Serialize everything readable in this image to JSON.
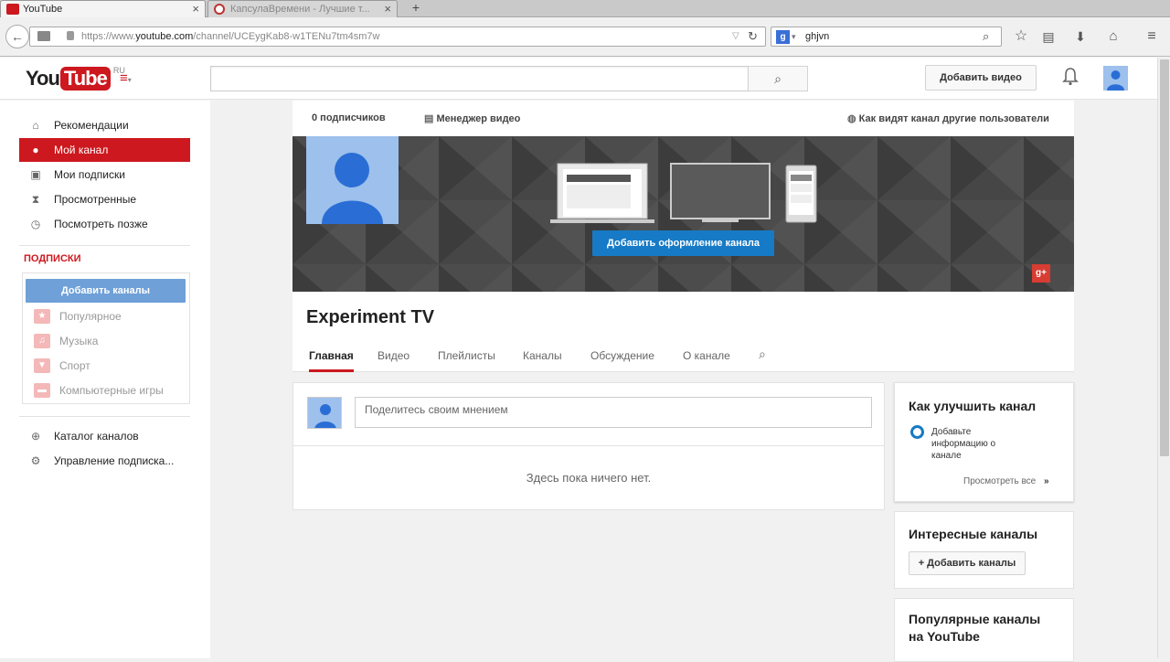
{
  "browser": {
    "tabs": [
      {
        "title": "YouTube",
        "active": true
      },
      {
        "title": "КапсулаВремени - Лучшие т...",
        "active": false
      }
    ],
    "url_prefix": "https://www.",
    "url_host": "youtube.com",
    "url_path": "/channel/UCEygKab8-w1TENu7tm4sm7w",
    "search_text": "ghjvn"
  },
  "header": {
    "logo_you": "You",
    "logo_tube": "Tube",
    "logo_region": "RU",
    "upload_label": "Добавить видео"
  },
  "sidebar": {
    "items": [
      {
        "label": "Рекомендации",
        "icon": "home-icon"
      },
      {
        "label": "Мой канал",
        "icon": "user-icon",
        "selected": true
      },
      {
        "label": "Мои подписки",
        "icon": "subscriptions-icon"
      },
      {
        "label": "Просмотренные",
        "icon": "hourglass-icon"
      },
      {
        "label": "Посмотреть позже",
        "icon": "clock-icon"
      }
    ],
    "subscriptions_heading": "ПОДПИСКИ",
    "add_channels_label": "Добавить каналы",
    "categories": [
      {
        "label": "Популярное",
        "icon": "star-icon"
      },
      {
        "label": "Музыка",
        "icon": "headphones-icon"
      },
      {
        "label": "Спорт",
        "icon": "trophy-icon"
      },
      {
        "label": "Компьютерные игры",
        "icon": "gamepad-icon"
      }
    ],
    "bottom_items": [
      {
        "label": "Каталог каналов",
        "icon": "plus-circle-icon"
      },
      {
        "label": "Управление подписка...",
        "icon": "gear-icon"
      }
    ]
  },
  "channel": {
    "subscribers": "0 подписчиков",
    "video_manager": "Менеджер видео",
    "view_as": "Как видят канал другие пользователи",
    "banner_button": "Добавить оформление канала",
    "gplus": "g+",
    "name": "Experiment TV",
    "tabs": [
      "Главная",
      "Видео",
      "Плейлисты",
      "Каналы",
      "Обсуждение",
      "О канале"
    ]
  },
  "feed": {
    "comment_placeholder": "Поделитесь своим мнением",
    "empty_text": "Здесь пока ничего нет."
  },
  "improve": {
    "title": "Как улучшить канал",
    "item_line1": "Добавьте",
    "item_line2": "информацию о",
    "item_line3": "канале",
    "view_all": "Просмотреть все",
    "view_all_arrow": "»"
  },
  "interesting": {
    "title": "Интересные каналы",
    "add_button": "+ Добавить каналы"
  },
  "popular": {
    "title_line1": "Популярные каналы",
    "title_line2": "на YouTube"
  },
  "colors": {
    "brand_red": "#cc181e",
    "accent_blue": "#167ac6"
  }
}
